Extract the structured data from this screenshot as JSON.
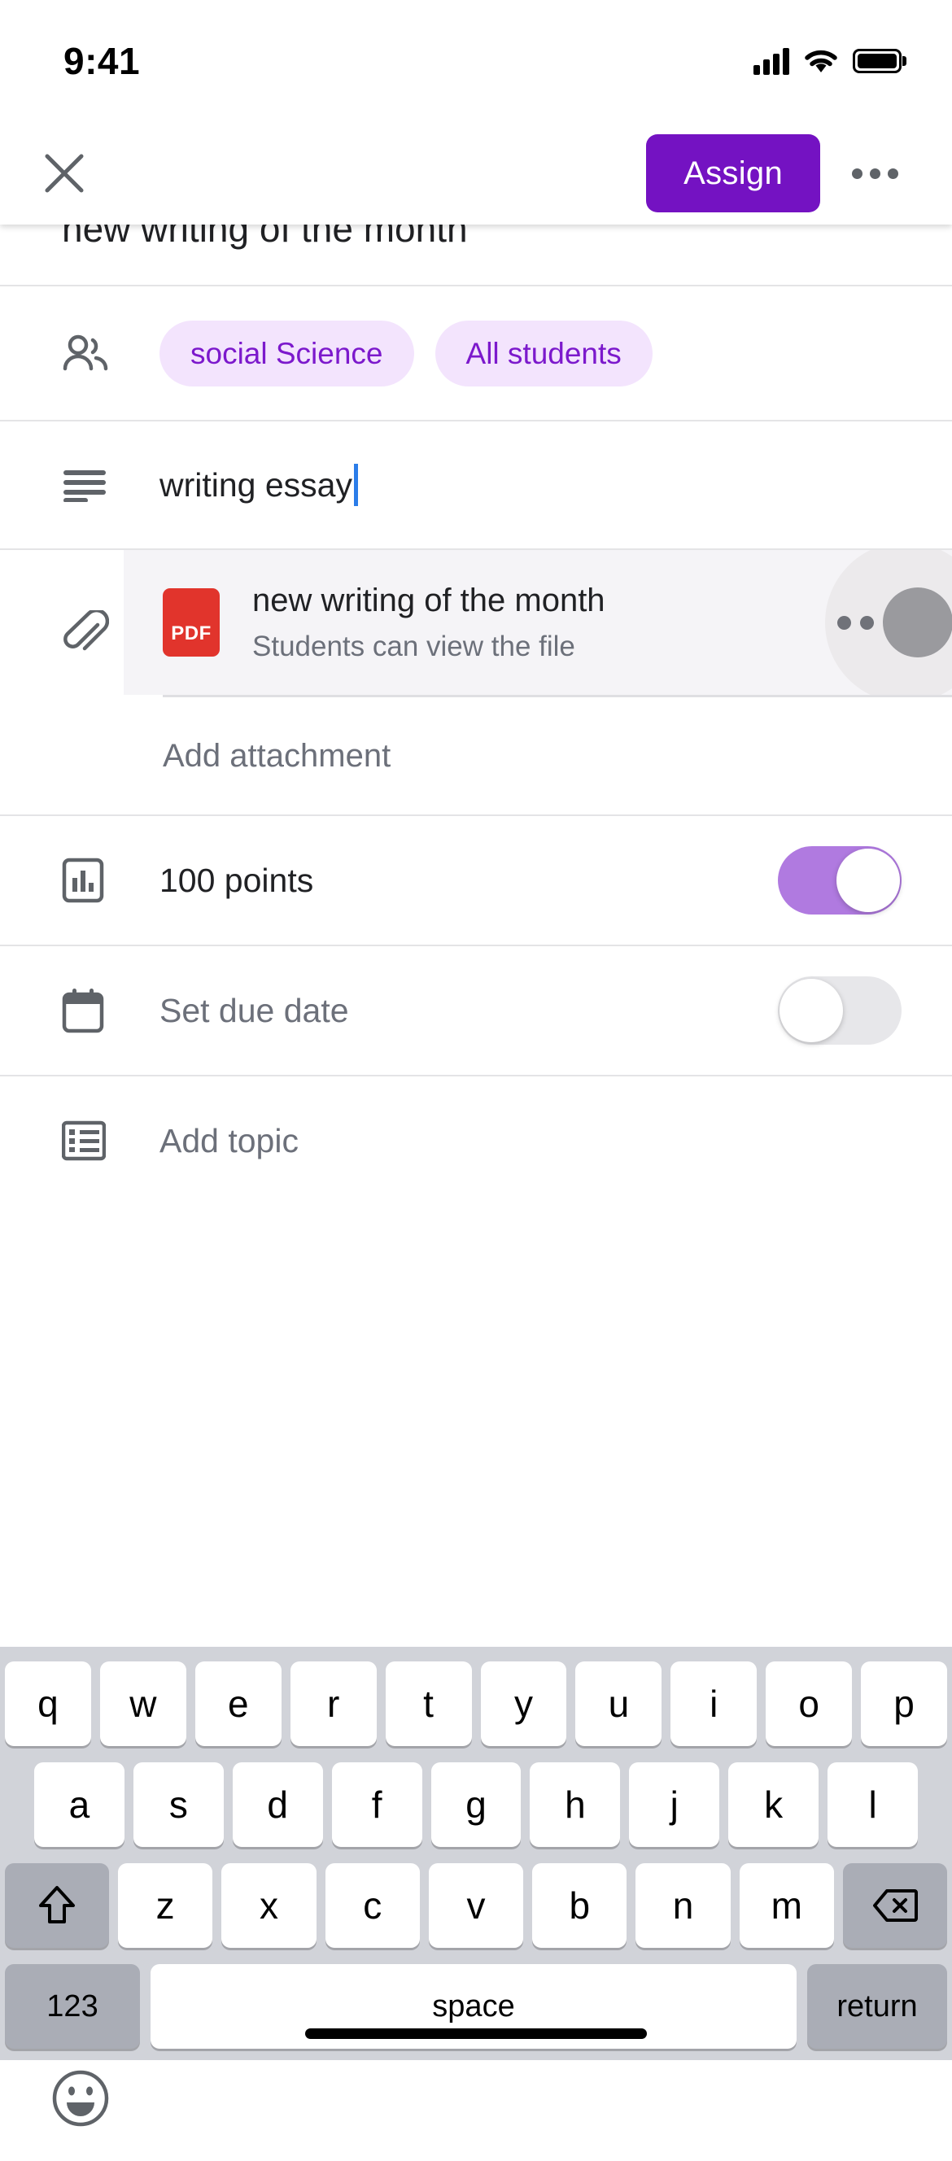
{
  "status_bar": {
    "time": "9:41",
    "signal_icon": "cellular-signal-icon",
    "wifi_icon": "wifi-icon",
    "battery_icon": "battery-full-icon"
  },
  "app_bar": {
    "close_icon": "close-icon",
    "assign_label": "Assign",
    "overflow_icon": "more-options-icon",
    "accent_color": "#7412c2"
  },
  "form": {
    "title_value": "new writing of the month",
    "audience": {
      "icon": "people-icon",
      "chips": [
        {
          "label": "social Science"
        },
        {
          "label": "All students"
        }
      ],
      "chip_bg": "#f3e4fd",
      "chip_text_color": "#7c19cc"
    },
    "instructions": {
      "icon": "text-lines-icon",
      "value": "writing essay",
      "caret_color": "#2b7de9"
    },
    "attachments": {
      "icon": "paperclip-icon",
      "items": [
        {
          "file_type_badge": "PDF",
          "badge_color": "#e1342c",
          "title": "new writing of the month",
          "subtitle": "Students can view the file",
          "menu_icon": "more-options-icon"
        }
      ],
      "add_label": "Add attachment"
    },
    "points": {
      "icon": "bar-chart-icon",
      "label": "100 points",
      "toggle_state": "on",
      "toggle_on_color": "#b07ae0"
    },
    "due_date": {
      "icon": "calendar-icon",
      "label": "Set due date",
      "toggle_state": "off",
      "toggle_off_color": "#e7e7ea"
    },
    "topic": {
      "icon": "list-icon",
      "label": "Add topic"
    }
  },
  "keyboard": {
    "row1": [
      "q",
      "w",
      "e",
      "r",
      "t",
      "y",
      "u",
      "i",
      "o",
      "p"
    ],
    "row2": [
      "a",
      "s",
      "d",
      "f",
      "g",
      "h",
      "j",
      "k",
      "l"
    ],
    "row3_letters": [
      "z",
      "x",
      "c",
      "v",
      "b",
      "n",
      "m"
    ],
    "shift_icon": "shift-icon",
    "backspace_icon": "backspace-icon",
    "numbers_label": "123",
    "space_label": "space",
    "return_label": "return",
    "emoji_icon": "emoji-icon"
  }
}
